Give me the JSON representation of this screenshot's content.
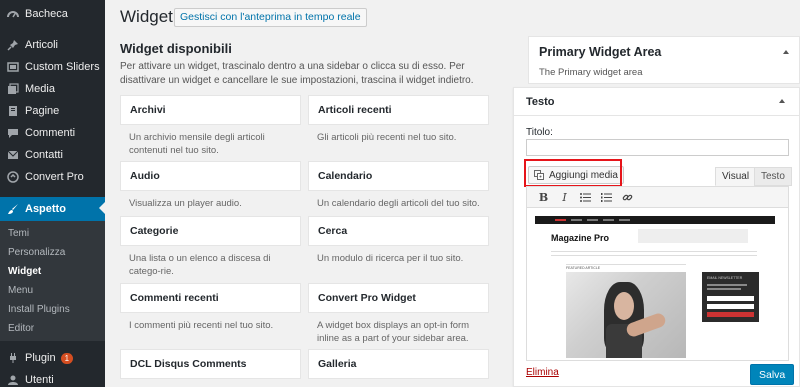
{
  "sidebar": {
    "items": [
      {
        "label": "Bacheca",
        "icon": "dashboard-icon"
      },
      {
        "label": "Articoli",
        "icon": "pin-icon"
      },
      {
        "label": "Custom Sliders",
        "icon": "slider-icon"
      },
      {
        "label": "Media",
        "icon": "media-icon"
      },
      {
        "label": "Pagine",
        "icon": "page-icon"
      },
      {
        "label": "Commenti",
        "icon": "comment-icon"
      },
      {
        "label": "Contatti",
        "icon": "mail-icon"
      },
      {
        "label": "Convert Pro",
        "icon": "convertpro-icon"
      },
      {
        "label": "Aspetto",
        "icon": "brush-icon"
      }
    ],
    "submenu": [
      "Temi",
      "Personalizza",
      "Widget",
      "Menu",
      "Install Plugins",
      "Editor"
    ],
    "plugin": {
      "label": "Plugin",
      "badge": "1"
    },
    "utenti": {
      "label": "Utenti"
    }
  },
  "header": {
    "title": "Widget",
    "preview_button": "Gestisci con l'anteprima in tempo reale"
  },
  "available": {
    "title": "Widget disponibili",
    "description": "Per attivare un widget, trascinalo dentro a una sidebar o clicca su di esso. Per disattivare un widget e cancellare le sue impostazioni, trascina il widget indietro.",
    "widgets": [
      {
        "name": "Archivi",
        "desc": "Un archivio mensile degli articoli contenuti nel tuo sito."
      },
      {
        "name": "Articoli recenti",
        "desc": "Gli articoli più recenti nel tuo sito."
      },
      {
        "name": "Audio",
        "desc": "Visualizza un player audio."
      },
      {
        "name": "Calendario",
        "desc": "Un calendario degli articoli del tuo sito."
      },
      {
        "name": "Categorie",
        "desc": "Una lista o un elenco a discesa di catego-rie."
      },
      {
        "name": "Cerca",
        "desc": "Un modulo di ricerca per il tuo sito."
      },
      {
        "name": "Commenti recenti",
        "desc": "I commenti più recenti nel tuo sito."
      },
      {
        "name": "Convert Pro Widget",
        "desc": "A widget box displays an opt-in form inline as a part of your sidebar area."
      },
      {
        "name": "DCL Disqus Comments",
        "desc": ""
      },
      {
        "name": "Galleria",
        "desc": ""
      }
    ]
  },
  "area": {
    "title": "Primary Widget Area",
    "subtitle": "The Primary widget area"
  },
  "text_widget": {
    "title": "Testo",
    "field_label": "Titolo:",
    "field_value": "",
    "add_media": "Aggiungi media",
    "tab_visual": "Visual",
    "tab_text": "Testo",
    "toolbar": {
      "bold": "B",
      "italic": "I"
    },
    "preview": {
      "site_title": "Magazine Pro",
      "featured_label": "FEATURED ARTICLE",
      "newsletter_label": "EMAIL NEWSLETTER"
    },
    "delete_link": "Elimina",
    "save_button": "Salva"
  },
  "colors": {
    "sidebar_bg": "#23282d",
    "active_blue": "#0073aa",
    "highlight_red": "#e6141a",
    "badge": "#d54e21"
  }
}
